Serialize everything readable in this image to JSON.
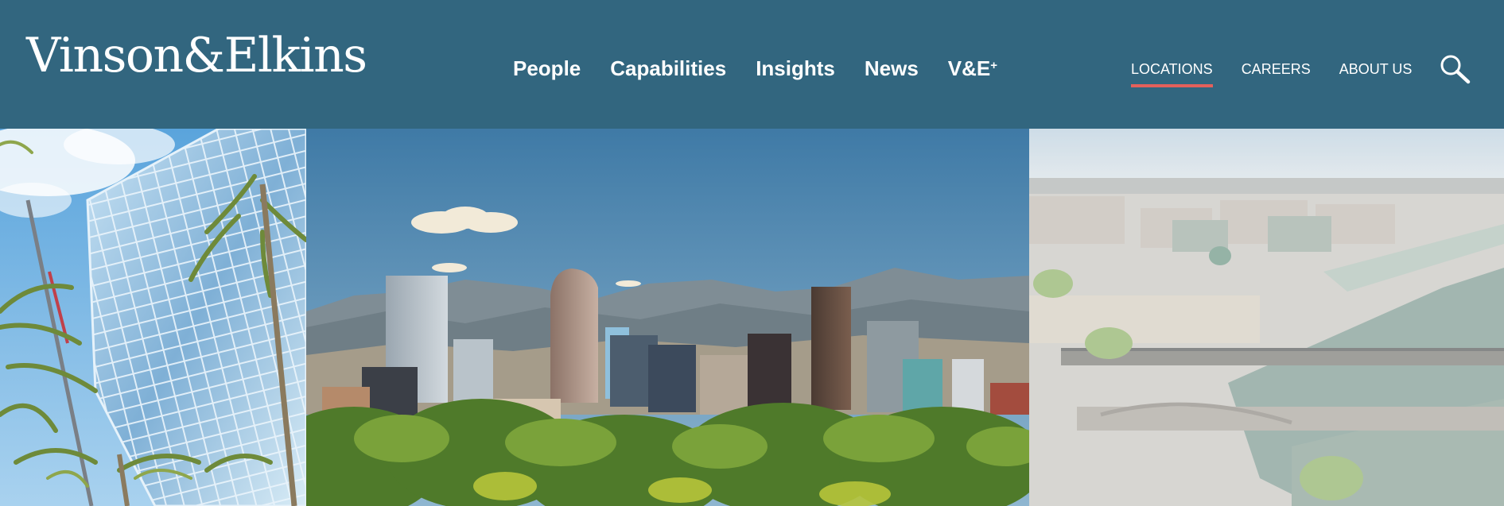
{
  "header": {
    "logo_text": "Vinson&Elkins",
    "main_nav": [
      {
        "label": "People"
      },
      {
        "label": "Capabilities"
      },
      {
        "label": "Insights"
      },
      {
        "label": "News"
      },
      {
        "label": "V&E",
        "superscript": "+"
      }
    ],
    "utility_nav": [
      {
        "label": "LOCATIONS",
        "active": true
      },
      {
        "label": "CAREERS"
      },
      {
        "label": "ABOUT US"
      }
    ],
    "search_icon": "search-icon"
  },
  "colors": {
    "header_bg": "#32667f",
    "nav_text": "#ffffff",
    "active_underline": "#e4605b"
  }
}
